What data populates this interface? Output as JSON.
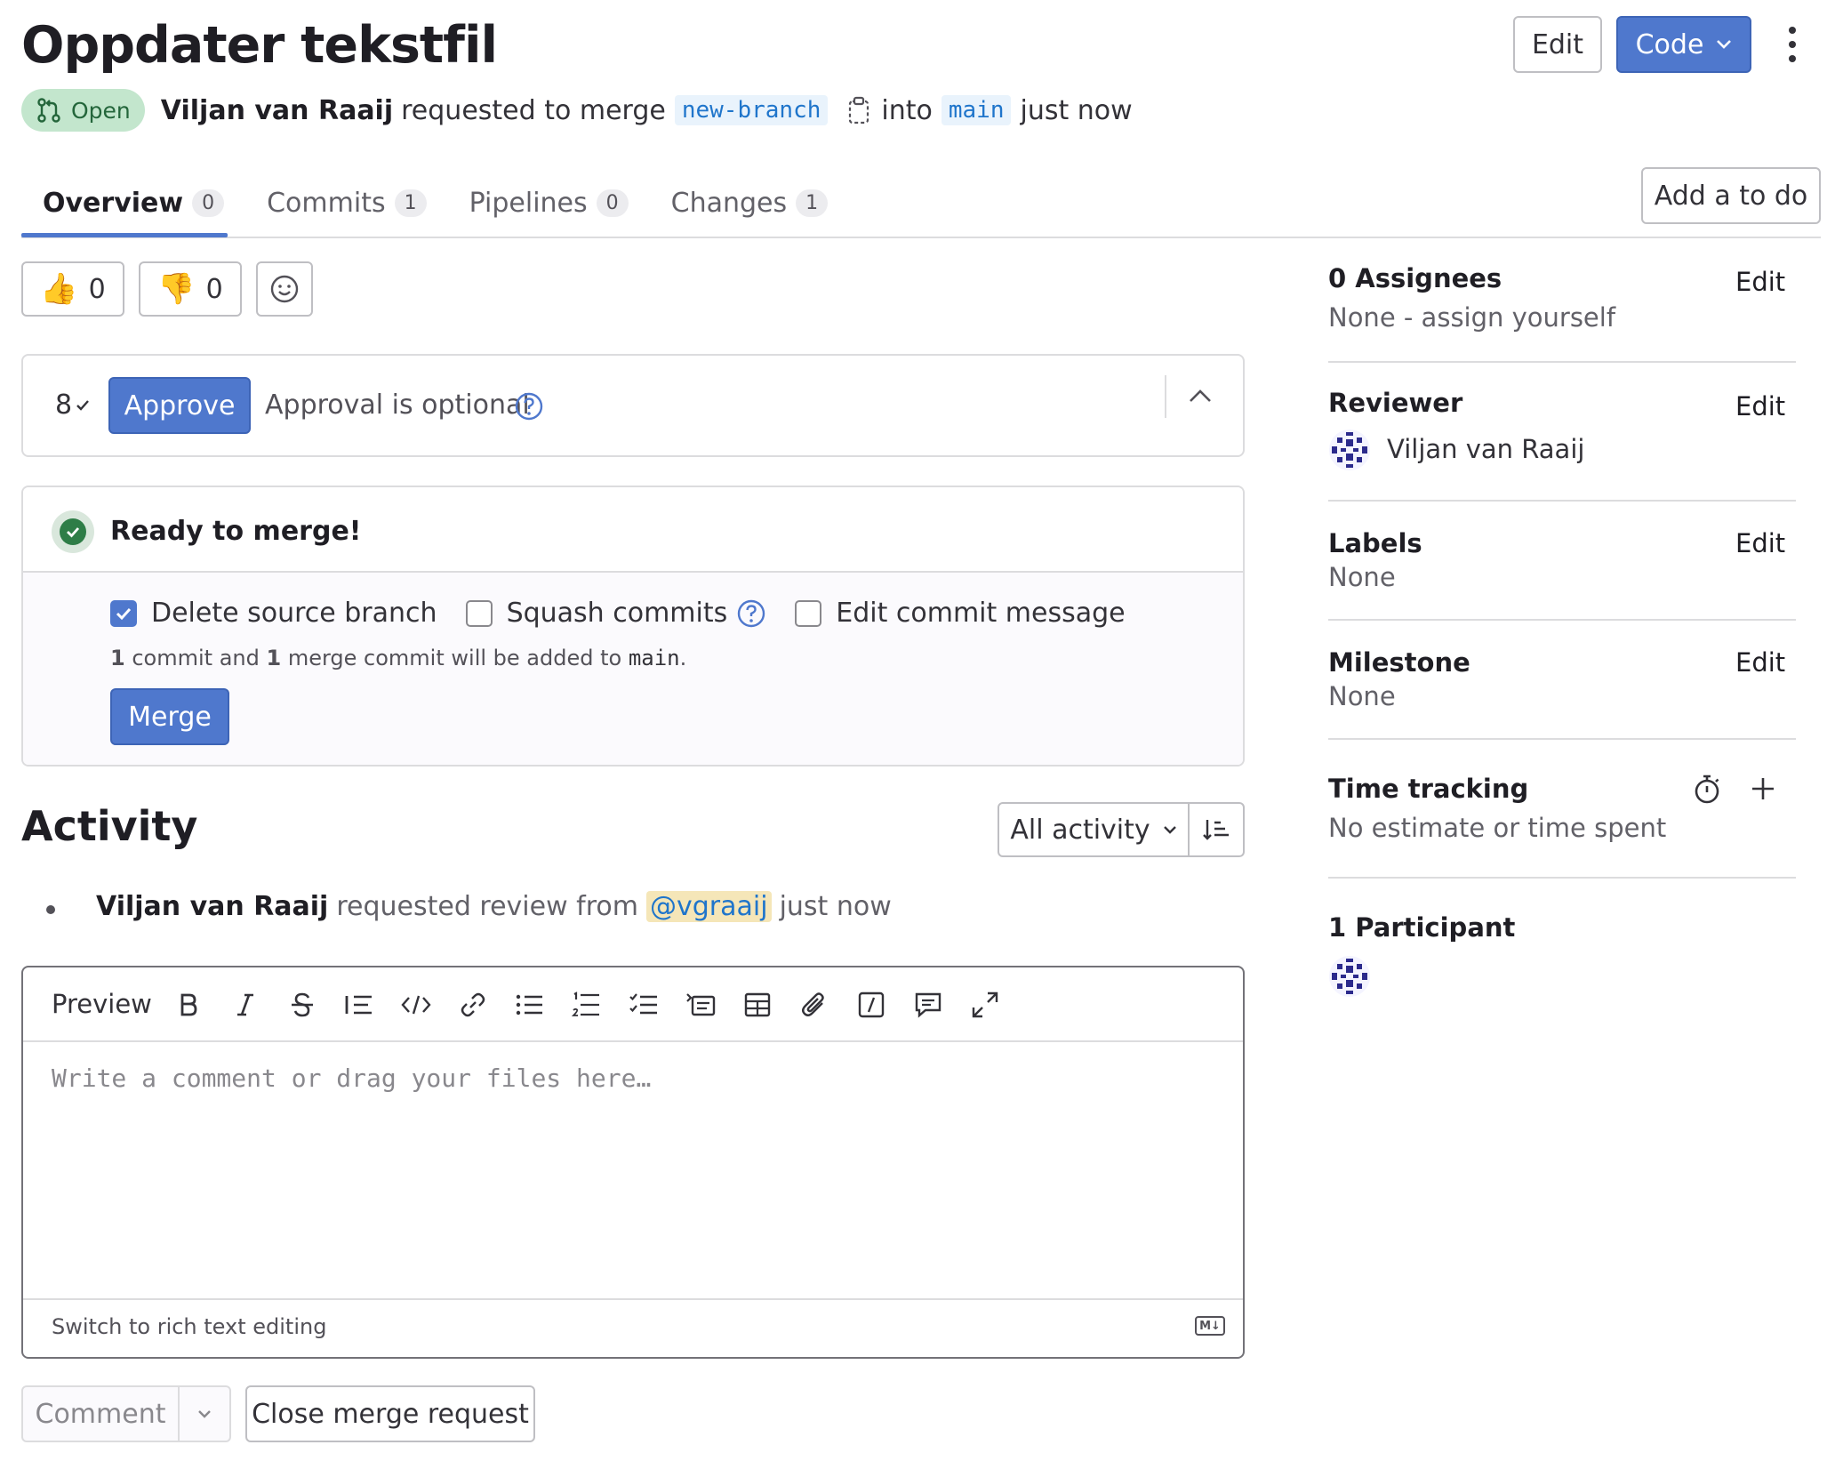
{
  "header": {
    "title": "Oppdater tekstfil",
    "edit_label": "Edit",
    "code_label": "Code",
    "status": "Open",
    "author": "Viljan van Raaij",
    "requested_text": "requested to merge",
    "source_branch": "new-branch",
    "into_text": "into",
    "target_branch": "main",
    "time": "just now"
  },
  "tabs": [
    {
      "label": "Overview",
      "count": "0"
    },
    {
      "label": "Commits",
      "count": "1"
    },
    {
      "label": "Pipelines",
      "count": "0"
    },
    {
      "label": "Changes",
      "count": "1"
    }
  ],
  "add_todo_label": "Add a to do",
  "reactions": {
    "thumbs_up": "0",
    "thumbs_down": "0"
  },
  "approval": {
    "approvers_indicator": "8",
    "approve_label": "Approve",
    "optional_text": "Approval is optional"
  },
  "merge": {
    "status": "Ready to merge!",
    "options": [
      {
        "label": "Delete source branch",
        "checked": true
      },
      {
        "label": "Squash commits",
        "checked": false
      },
      {
        "label": "Edit commit message",
        "checked": false
      }
    ],
    "summary": {
      "count_a": "1",
      "text_a": "commit and",
      "count_b": "1",
      "text_b": "merge commit will be added to",
      "branch": "main",
      "end": "."
    },
    "merge_label": "Merge"
  },
  "activity": {
    "heading": "Activity",
    "filter_label": "All activity",
    "items": [
      {
        "author": "Viljan van Raaij",
        "text": "requested review from",
        "mention": "@vgraaij",
        "time": "just now"
      }
    ]
  },
  "editor": {
    "preview_label": "Preview",
    "placeholder": "Write a comment or drag your files here…",
    "switch_label": "Switch to rich text editing",
    "markdown_badge": "M↓",
    "toolbar_icons": [
      "bold-icon",
      "italic-icon",
      "strikethrough-icon",
      "quote-icon",
      "code-icon",
      "link-icon",
      "bulleted-list-icon",
      "numbered-list-icon",
      "task-list-icon",
      "collapsible-icon",
      "table-icon",
      "attach-icon",
      "slash-command-icon",
      "comment-template-icon",
      "fullscreen-icon"
    ]
  },
  "comment_label": "Comment",
  "close_mr_label": "Close merge request",
  "sidebar": {
    "edit_label": "Edit",
    "assignees_title": "0 Assignees",
    "assignees_value": "None - assign yourself",
    "reviewer_title": "Reviewer",
    "reviewer_name": "Viljan van Raaij",
    "labels_title": "Labels",
    "labels_value": "None",
    "milestone_title": "Milestone",
    "milestone_value": "None",
    "time_title": "Time tracking",
    "time_value": "No estimate or time spent",
    "participants_title": "1 Participant"
  },
  "colors": {
    "accent": "#4f78cd",
    "success": "#2e7d47",
    "open_badge_bg": "#c3e6cd",
    "mention_bg": "#f5e6b8"
  }
}
